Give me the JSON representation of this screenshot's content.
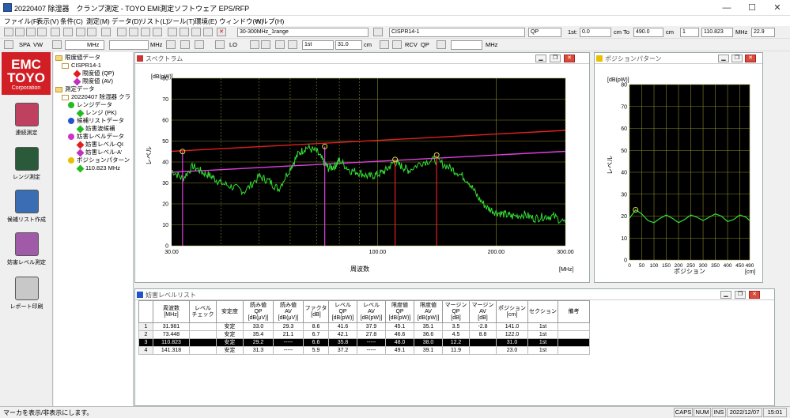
{
  "window": {
    "title": "20220407 除湿器　クランプ測定 - TOYO EMI測定ソフトウェア EPS/RFP",
    "minimize": "—",
    "maximize": "☐",
    "close": "✕"
  },
  "menu": [
    "ファイル(F)",
    "表示(V)",
    "条件(C)",
    "測定(M)",
    "データ(D)",
    "リスト(L)",
    "ツール(T)",
    "環境(E)",
    "ウィンドウ(W)",
    "ヘルプ(H)"
  ],
  "toolbar1": {
    "range_select": "30-300MHz_1range",
    "limit_select": "CISPR14-1",
    "detector_select": "QP",
    "range_1st_label": "1st:",
    "range_start": "0.0",
    "unit_cm1": "cm",
    "to_label": "To",
    "range_end": "490.0",
    "unit_cm2": "cm",
    "count": "1",
    "freq": "110.823",
    "unit_mhz": "MHz",
    "level": "22.9"
  },
  "toolbar2": {
    "spa_label": "SPA",
    "vw_label": "VW",
    "unit_mhz_a": "MHz",
    "unit_mhz_b": "MHz",
    "lo_label": "LO",
    "first_label": "1st",
    "pos_value": "31.0",
    "unit_cm": "cm",
    "rcv_label": "RCV",
    "qp_label": "QP",
    "unit_mhz_c": "MHz"
  },
  "logo": {
    "line1": "EMC",
    "line2": "TOYO",
    "line3": "Corporation"
  },
  "sidebar_buttons": [
    "連続測定",
    "レンジ測定",
    "候補リスト作成",
    "妨害レベル測定",
    "レポート印刷"
  ],
  "tree": {
    "n1": "限度値データ",
    "n2": "CISPR14-1",
    "n3": "限度値 (QP)",
    "n4": "限度値 (AV)",
    "n5": "測定データ",
    "n6": "20220407 除湿器 クラ",
    "n7": "レンジデータ",
    "n8": "レンジ (PK)",
    "n9": "候補リストデータ",
    "n10": "妨害波候補",
    "n11": "妨害レベルデータ",
    "n12": "妨害レベル-QI",
    "n13": "妨害レベル-A'",
    "n14": "ポジションパターン",
    "n15": "110.823 MHz"
  },
  "spectrum": {
    "title": "スペクトラム",
    "yunit": "[dB(pW)]",
    "ylabel": "レベル",
    "xlabel": "周波数",
    "xunit": "[MHz]",
    "yticks": [
      "0",
      "10",
      "20",
      "30",
      "40",
      "50",
      "60",
      "70",
      "80"
    ],
    "xticks": [
      "30.00",
      "100.00",
      "200.00",
      "300.00"
    ]
  },
  "chart_data": [
    {
      "type": "line",
      "title": "スペクトラム",
      "xlabel": "周波数",
      "ylabel": "レベル",
      "xunit": "[MHz]",
      "yunit": "[dB(pW)]",
      "xscale": "log",
      "xlim": [
        30,
        300
      ],
      "ylim": [
        0,
        80
      ],
      "series": [
        {
          "color": "#e02020",
          "x": [
            30,
            300
          ],
          "y": [
            45.1,
            55.1
          ]
        },
        {
          "color": "#e040e0",
          "x": [
            30,
            300
          ],
          "y": [
            35.1,
            45.1
          ]
        },
        {
          "color": "#33dd33",
          "x": [
            30,
            32,
            34,
            36,
            38,
            40,
            43,
            46,
            50,
            53,
            56,
            60,
            63,
            66,
            70,
            73,
            75,
            78,
            80,
            85,
            90,
            95,
            100,
            105,
            110,
            115,
            120,
            130,
            140,
            150,
            160,
            170,
            180,
            190,
            200,
            210,
            220,
            235,
            250,
            265,
            280,
            300
          ],
          "y": [
            36,
            32,
            38,
            35,
            33,
            30,
            28,
            26,
            33,
            31,
            27,
            37,
            44,
            47,
            45,
            40,
            37,
            38,
            41,
            36,
            35,
            33,
            34,
            36,
            40,
            38,
            36,
            40,
            41,
            38,
            35,
            31,
            23,
            18,
            16,
            15,
            14,
            15,
            13,
            14,
            14,
            11
          ]
        },
        {
          "color": "#e02020",
          "type": "marker",
          "x": [
            110.823,
            141.318
          ],
          "y": [
            29.2,
            31.3
          ]
        },
        {
          "color": "#e040e0",
          "type": "marker",
          "x": [
            31.981,
            73.448
          ],
          "y": [
            33.0,
            35.4
          ]
        }
      ]
    },
    {
      "type": "line",
      "title": "ポジションパターン",
      "xlabel": "ポジション",
      "ylabel": "レベル",
      "xunit": "[cm]",
      "yunit": "[dB(pW)]",
      "xlim": [
        0,
        490
      ],
      "ylim": [
        0,
        80
      ],
      "series": [
        {
          "color": "#33dd33",
          "x": [
            0,
            25,
            50,
            75,
            100,
            125,
            150,
            175,
            200,
            225,
            250,
            275,
            300,
            325,
            350,
            375,
            400,
            425,
            450,
            475,
            490
          ],
          "y": [
            19,
            22.9,
            21,
            18,
            17,
            19,
            20.5,
            19,
            17,
            18.5,
            20.5,
            19.5,
            18,
            19.5,
            21,
            20,
            17.5,
            18.5,
            20.5,
            19.5,
            18
          ]
        }
      ]
    }
  ],
  "position": {
    "title": "ポジションパターン",
    "yunit": "[dB(pW)]",
    "ylabel": "レベル",
    "xlabel": "ポジション",
    "xunit": "[cm]",
    "yticks": [
      "0",
      "10",
      "20",
      "30",
      "40",
      "50",
      "60",
      "70",
      "80"
    ],
    "xticks": [
      "0",
      "50",
      "100",
      "150",
      "200",
      "250",
      "300",
      "350",
      "400",
      "450",
      "490"
    ]
  },
  "list": {
    "title": "妨害レベルリスト",
    "headers": [
      "周波数\n[MHz]",
      "レベル\nチェック",
      "安定度",
      "読み値\nQP\n[dB(μV)]",
      "読み値\nAV\n[dB(μV)]",
      "ファクタ\n[dB]",
      "レベル\nQP\n[dB(pW)]",
      "レベル\nAV\n[dB(pW)]",
      "限度値\nQP\n[dB(pW)]",
      "限度値\nAV\n[dB(pW)]",
      "マージン\nQP\n[dB]",
      "マージン\nAV\n[dB]",
      "ポジション\n[cm]",
      "セクション",
      "備考"
    ],
    "rows": [
      {
        "n": "1",
        "c": [
          "31.981",
          "",
          "安定",
          "33.0",
          "29.3",
          "8.6",
          "41.6",
          "37.9",
          "45.1",
          "35.1",
          "3.5",
          "-2.8",
          "141.0",
          "1st",
          ""
        ]
      },
      {
        "n": "2",
        "c": [
          "73.448",
          "",
          "安定",
          "35.4",
          "21.1",
          "6.7",
          "42.1",
          "27.8",
          "46.6",
          "36.6",
          "4.5",
          "8.8",
          "122.0",
          "1st",
          ""
        ]
      },
      {
        "n": "3",
        "c": [
          "110.823",
          "",
          "安定",
          "29.2",
          "-----",
          "6.6",
          "35.8",
          "-----",
          "48.0",
          "38.0",
          "12.2",
          "",
          "31.0",
          "1st",
          ""
        ]
      },
      {
        "n": "4",
        "c": [
          "141.318",
          "",
          "安定",
          "31.3",
          "-----",
          "5.9",
          "37.2",
          "-----",
          "49.1",
          "39.1",
          "11.9",
          "",
          "23.0",
          "1st",
          ""
        ]
      }
    ]
  },
  "status": {
    "message": "マーカを表示/非表示にします。",
    "caps": "CAPS",
    "num": "NUM",
    "ins": "INS",
    "date": "2022/12/07",
    "time": "15:01"
  }
}
